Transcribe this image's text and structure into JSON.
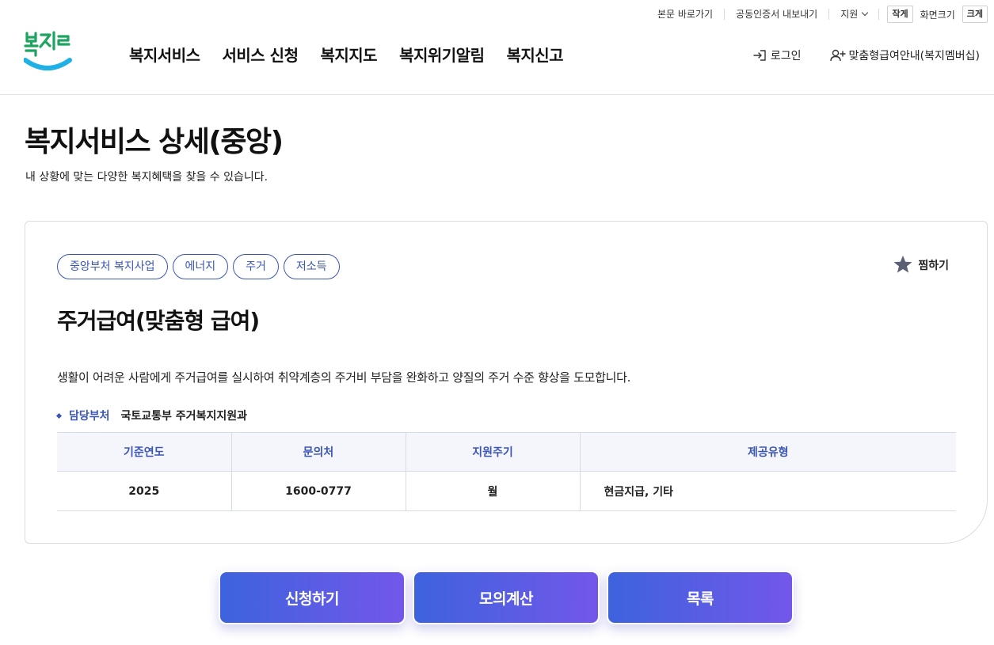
{
  "utility": {
    "skip": "본문 바로가기",
    "cert": "공동인증서 내보내기",
    "support": "지원",
    "font_small": "작게",
    "font_label": "화면크기",
    "font_large": "크게"
  },
  "logo": {
    "text": "복지로"
  },
  "nav": {
    "items": [
      {
        "label": "복지서비스"
      },
      {
        "label": "서비스 신청"
      },
      {
        "label": "복지지도"
      },
      {
        "label": "복지위기알림"
      },
      {
        "label": "복지신고"
      }
    ],
    "login": "로그인",
    "membership": "맞춤형급여안내(복지멤버십)"
  },
  "page": {
    "title": "복지서비스 상세(중앙)",
    "subtitle": "내 상황에 맞는 다양한 복지혜택을 찾을 수 있습니다."
  },
  "service": {
    "tags": [
      "중앙부처 복지사업",
      "에너지",
      "주거",
      "저소득"
    ],
    "favorite": "찜하기",
    "title": "주거급여(맞춤형 급여)",
    "description": "생활이 어려운 사람에게 주거급여를 실시하여 취약계층의 주거비 부담을 완화하고 양질의 주거 수준 향상을 도모합니다.",
    "dept_label": "담당부처",
    "dept_value": "국토교통부 주거복지지원과",
    "table": {
      "headers": [
        "기준연도",
        "문의처",
        "지원주기",
        "제공유형"
      ],
      "row": [
        "2025",
        "1600-0777",
        "월",
        "현금지급, 기타"
      ]
    }
  },
  "actions": {
    "apply": "신청하기",
    "simulate": "모의계산",
    "list": "목록"
  },
  "colors": {
    "accent": "#3b56b5",
    "button_start": "#3d63dd",
    "button_end": "#7357ea",
    "logo_green": "#1fa361",
    "logo_blue": "#1fb0e6"
  }
}
